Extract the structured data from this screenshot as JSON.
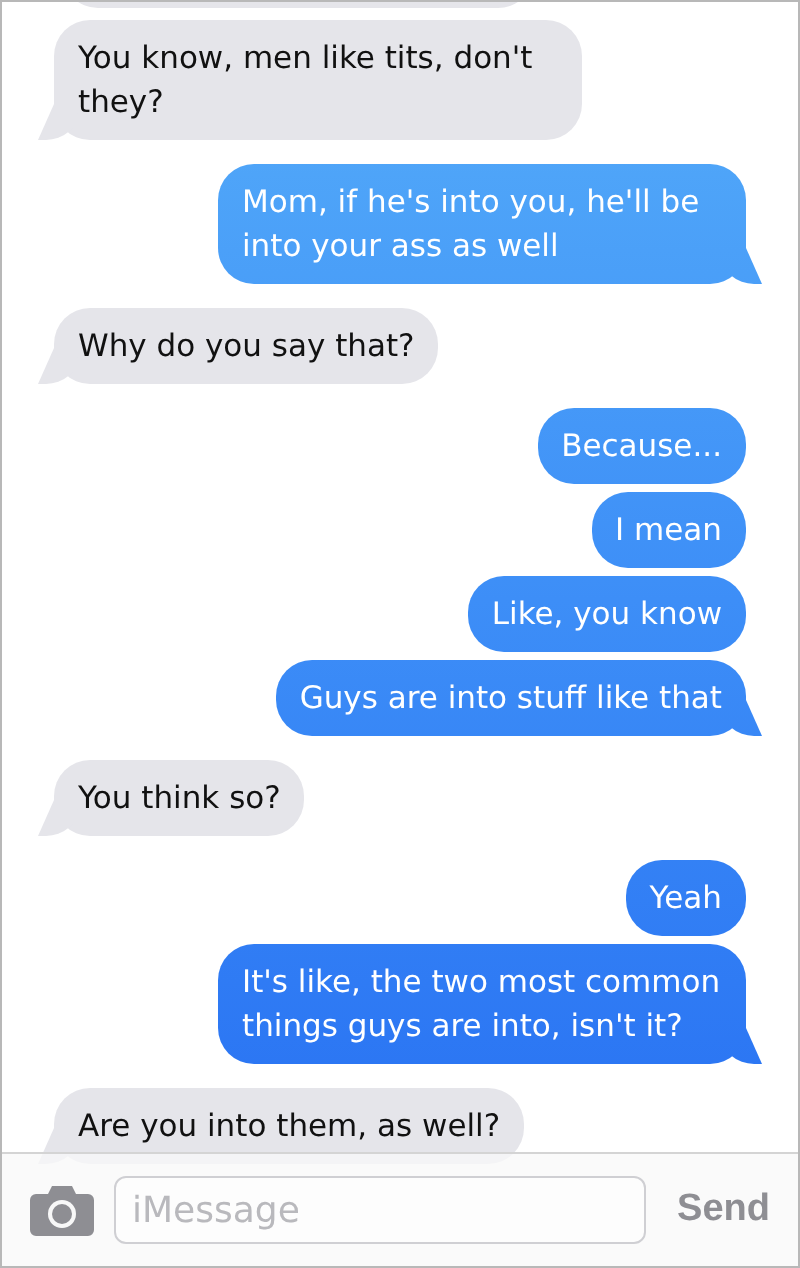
{
  "messages": [
    {
      "kind": "incoming",
      "text": "You know, men like tits, don't they?"
    },
    {
      "kind": "outgoing",
      "text": "Mom, if he's into you, he'll be into your ass as well"
    },
    {
      "kind": "incoming",
      "text": "Why do you say that?"
    },
    {
      "kind": "outgoing",
      "text": "Because..."
    },
    {
      "kind": "outgoing",
      "text": "I mean"
    },
    {
      "kind": "outgoing",
      "text": "Like, you know"
    },
    {
      "kind": "outgoing",
      "text": "Guys are into stuff like that"
    },
    {
      "kind": "incoming",
      "text": "You think so?"
    },
    {
      "kind": "outgoing",
      "text": "Yeah"
    },
    {
      "kind": "outgoing",
      "text": "It's like, the two most common things guys are into, isn't it?"
    },
    {
      "kind": "incoming",
      "text": "Are you into them, as well?"
    }
  ],
  "composer": {
    "placeholder": "iMessage",
    "send": "Send"
  }
}
